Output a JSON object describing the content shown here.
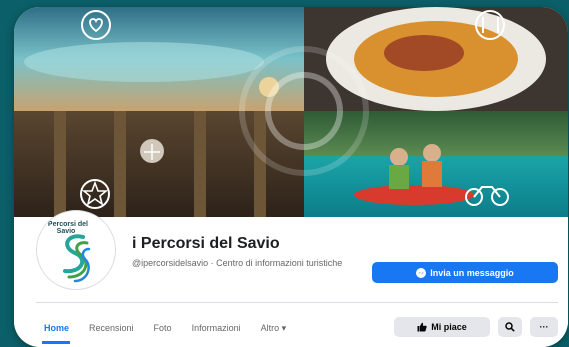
{
  "page": {
    "name": "i Percorsi del Savio",
    "handle_category": "@ipercorsidelsavio · Centro di informazioni turistiche",
    "logo_text": "i Percorsi del Savio"
  },
  "actions": {
    "message_label": "Invia un messaggio",
    "like_label": "Mi piace",
    "more_label": "···"
  },
  "tabs": [
    {
      "label": "Home",
      "active": true
    },
    {
      "label": "Recensioni"
    },
    {
      "label": "Foto"
    },
    {
      "label": "Informazioni"
    },
    {
      "label": "Altro ▾"
    }
  ],
  "cover": {
    "icons": [
      "heart-icon",
      "food-icon",
      "star-icon",
      "bicycle-icon",
      "church-window-icon"
    ]
  },
  "colors": {
    "accent": "#1877f2",
    "background": "#0b5f68"
  }
}
